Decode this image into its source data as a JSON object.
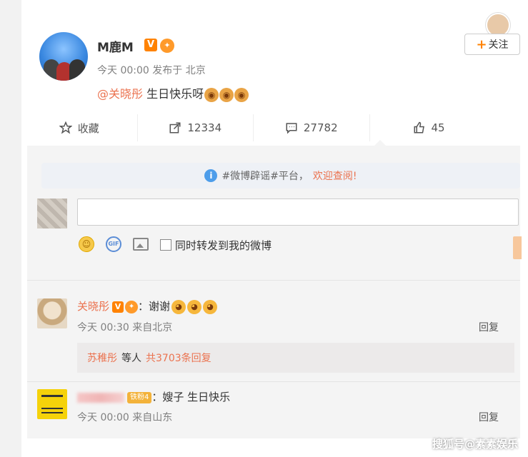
{
  "post": {
    "username": "M鹿M",
    "verified_badge": "V",
    "time": "今天 00:00",
    "location_prefix": "发布于",
    "location": "北京",
    "mention": "@关晓彤",
    "text": " 生日快乐呀",
    "follow_label": "关注"
  },
  "actions": {
    "favorite": "收藏",
    "repost": "12334",
    "comment": "27782",
    "like": "45"
  },
  "notice": {
    "tag": "#微博辟谣#平台，",
    "link": "欢迎查阅!"
  },
  "composer": {
    "placeholder": "",
    "repost_checkbox_label": "同时转发到我的微博"
  },
  "comments": [
    {
      "name": "关晓彤",
      "text": "：谢谢",
      "time": "今天 00:30 来自北京",
      "reply_label": "回复"
    },
    {
      "name": "",
      "fan_badge": "铁粉4",
      "text": "：嫂子 生日快乐",
      "time": "今天 00:00 来自山东",
      "reply_label": "回复"
    }
  ],
  "subreplies": {
    "name": "苏稚彤",
    "middle": "等人",
    "count_text": "共3703条回复"
  },
  "watermark": "搜狐号@素素娱乐",
  "colors": {
    "accent": "#ff8200",
    "link": "#eb7350",
    "muted": "#808080"
  }
}
